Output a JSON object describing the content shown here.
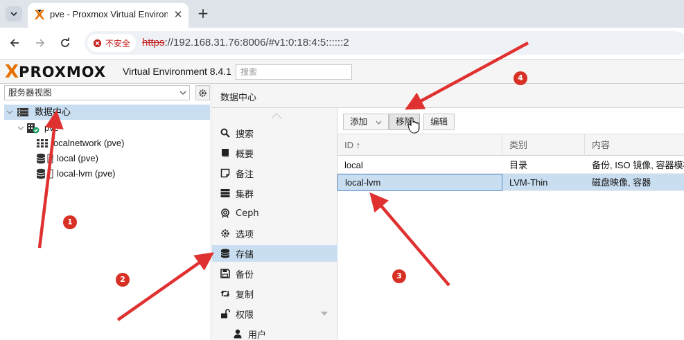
{
  "browser": {
    "tab_title": "pve - Proxmox Virtual Environment",
    "new_tab": "+",
    "security_label": "不安全",
    "url_scheme": "https",
    "url_rest": "://192.168.31.76:8006/#v1:0:18:4:5::::::2"
  },
  "header": {
    "logo_x": "X",
    "logo_word": "PROXMOX",
    "product": "Virtual Environment 8.4.1",
    "search_placeholder": "搜索"
  },
  "resource_tree": {
    "view_select": "服务器视图",
    "nodes": [
      {
        "label": "数据中心",
        "icon": "datacenter-icon"
      },
      {
        "label": "pve",
        "icon": "node-icon"
      },
      {
        "label": "localnetwork (pve)",
        "icon": "network-icon"
      },
      {
        "label": "local (pve)",
        "icon": "storage-icon"
      },
      {
        "label": "local-lvm (pve)",
        "icon": "storage-icon"
      }
    ]
  },
  "main": {
    "title": "数据中心",
    "nav": [
      {
        "label": "搜索",
        "icon": "search-icon"
      },
      {
        "label": "概要",
        "icon": "book-icon"
      },
      {
        "label": "备注",
        "icon": "note-icon"
      },
      {
        "label": "集群",
        "icon": "server-icon"
      },
      {
        "label": "Ceph",
        "icon": "ceph-icon"
      },
      {
        "label": "选项",
        "icon": "gear-icon"
      },
      {
        "label": "存储",
        "icon": "database-icon"
      },
      {
        "label": "备份",
        "icon": "floppy-icon"
      },
      {
        "label": "复制",
        "icon": "retweet-icon"
      },
      {
        "label": "权限",
        "icon": "unlock-icon"
      },
      {
        "label": "用户",
        "icon": "user-icon"
      }
    ],
    "toolbar": {
      "add": "添加",
      "remove": "移除",
      "edit": "编辑"
    },
    "columns": [
      "ID ↑",
      "类别",
      "内容"
    ],
    "rows": [
      {
        "id": "local",
        "type": "目录",
        "content": "备份, ISO 镜像, 容器模板"
      },
      {
        "id": "local-lvm",
        "type": "LVM-Thin",
        "content": "磁盘映像, 容器"
      }
    ]
  },
  "annotations": {
    "badges": [
      "1",
      "2",
      "3",
      "4"
    ],
    "arrow_color": "#e03131"
  }
}
